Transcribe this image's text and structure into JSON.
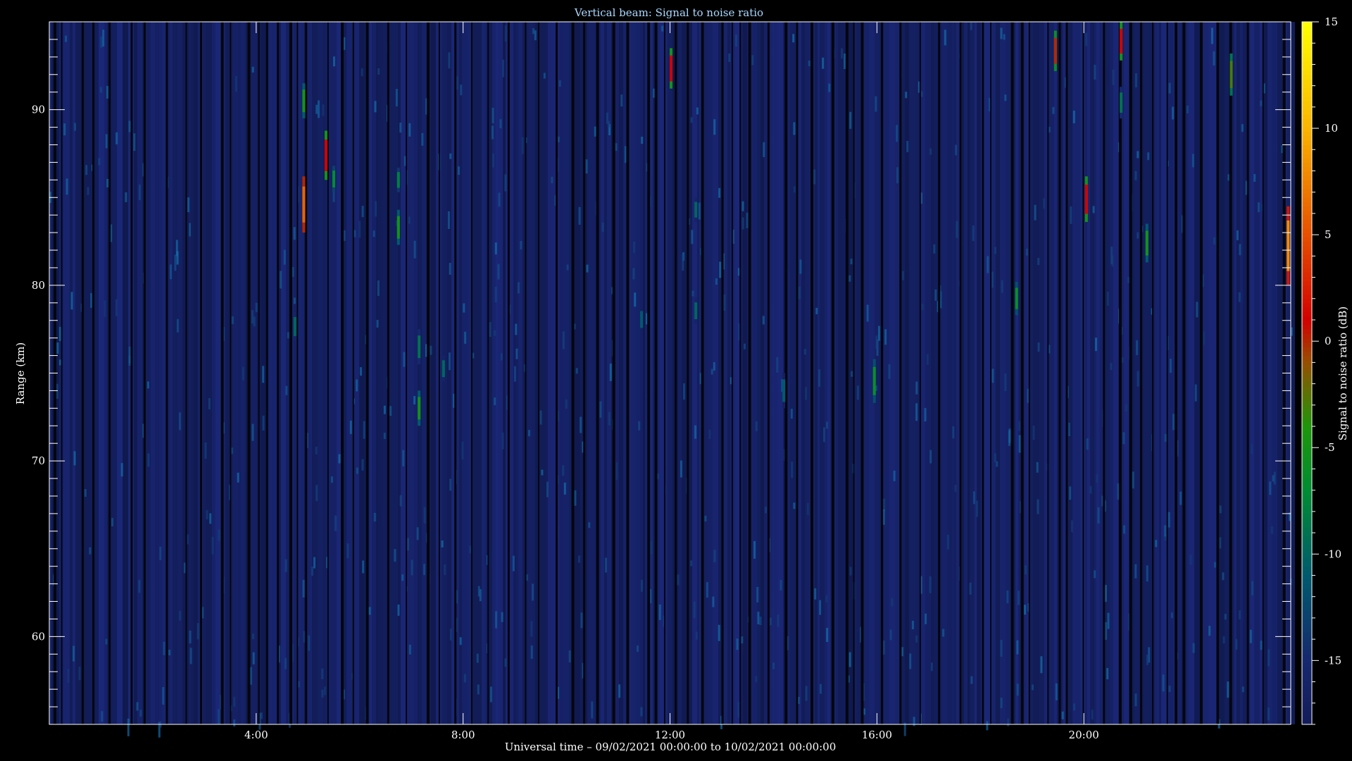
{
  "chart_data": {
    "type": "heatmap",
    "title": "Vertical beam: Signal to noise ratio",
    "xlabel": "Universal time – 09/02/2021 00:00:00 to 10/02/2021 00:00:00",
    "ylabel": "Range (km)",
    "colorbar_label": "Signal to noise ratio (dB)",
    "x_range_hours": [
      0,
      24
    ],
    "y_range_km": [
      55,
      95
    ],
    "x_ticks": [
      {
        "hour": 4,
        "label": "4:00"
      },
      {
        "hour": 8,
        "label": "8:00"
      },
      {
        "hour": 12,
        "label": "12:00"
      },
      {
        "hour": 16,
        "label": "16:00"
      },
      {
        "hour": 20,
        "label": "20:00"
      }
    ],
    "y_ticks": [
      {
        "km": 60,
        "label": "60"
      },
      {
        "km": 70,
        "label": "70"
      },
      {
        "km": 80,
        "label": "80"
      },
      {
        "km": 90,
        "label": "90"
      }
    ],
    "colorbar_range_db": [
      -18,
      15
    ],
    "colorbar_ticks": [
      {
        "db": 15,
        "label": "15"
      },
      {
        "db": 10,
        "label": "10"
      },
      {
        "db": 5,
        "label": "5"
      },
      {
        "db": 0,
        "label": "0"
      },
      {
        "db": -5,
        "label": "-5"
      },
      {
        "db": -10,
        "label": "-10"
      },
      {
        "db": -15,
        "label": "-15"
      }
    ],
    "background_db": -16,
    "colors": {
      "background": "#000000",
      "field": "#141c5a",
      "axis": "#ffffff",
      "title": "#aad8ff"
    },
    "echoes": [
      {
        "hour": 4.92,
        "km_start": 89.5,
        "km_end": 91.5,
        "db": -5
      },
      {
        "hour": 4.92,
        "km_start": 83.0,
        "km_end": 86.2,
        "db": 6
      },
      {
        "hour": 5.35,
        "km_start": 86.0,
        "km_end": 88.8,
        "db": 1
      },
      {
        "hour": 5.5,
        "km_start": 85.3,
        "km_end": 86.8,
        "db": -7
      },
      {
        "hour": 6.75,
        "km_start": 82.3,
        "km_end": 84.3,
        "db": -5
      },
      {
        "hour": 6.75,
        "km_start": 85.3,
        "km_end": 86.7,
        "db": -8
      },
      {
        "hour": 7.15,
        "km_start": 72.0,
        "km_end": 74.0,
        "db": -5
      },
      {
        "hour": 7.15,
        "km_start": 75.5,
        "km_end": 77.5,
        "db": -9
      },
      {
        "hour": 7.62,
        "km_start": 74.5,
        "km_end": 76.0,
        "db": -10
      },
      {
        "hour": 4.75,
        "km_start": 76.8,
        "km_end": 78.5,
        "db": -10
      },
      {
        "hour": 11.45,
        "km_start": 77.3,
        "km_end": 78.8,
        "db": -11
      },
      {
        "hour": 12.02,
        "km_start": 91.2,
        "km_end": 93.5,
        "db": 1
      },
      {
        "hour": 12.5,
        "km_start": 77.8,
        "km_end": 79.3,
        "db": -10
      },
      {
        "hour": 12.5,
        "km_start": 83.6,
        "km_end": 85.0,
        "db": -10
      },
      {
        "hour": 14.2,
        "km_start": 73.0,
        "km_end": 75.0,
        "db": -11
      },
      {
        "hour": 15.95,
        "km_start": 73.3,
        "km_end": 75.8,
        "db": -6
      },
      {
        "hour": 18.7,
        "km_start": 78.3,
        "km_end": 80.2,
        "db": -6
      },
      {
        "hour": 19.45,
        "km_start": 92.2,
        "km_end": 94.5,
        "db": 0
      },
      {
        "hour": 20.05,
        "km_start": 83.6,
        "km_end": 86.2,
        "db": 1
      },
      {
        "hour": 20.72,
        "km_start": 92.8,
        "km_end": 95.0,
        "db": 1
      },
      {
        "hour": 20.72,
        "km_start": 89.5,
        "km_end": 91.3,
        "db": -9
      },
      {
        "hour": 21.22,
        "km_start": 81.3,
        "km_end": 83.5,
        "db": -5
      },
      {
        "hour": 22.85,
        "km_start": 90.8,
        "km_end": 93.2,
        "db": -3
      },
      {
        "hour": 23.95,
        "km_start": 80.0,
        "km_end": 84.5,
        "db": 8
      }
    ]
  }
}
